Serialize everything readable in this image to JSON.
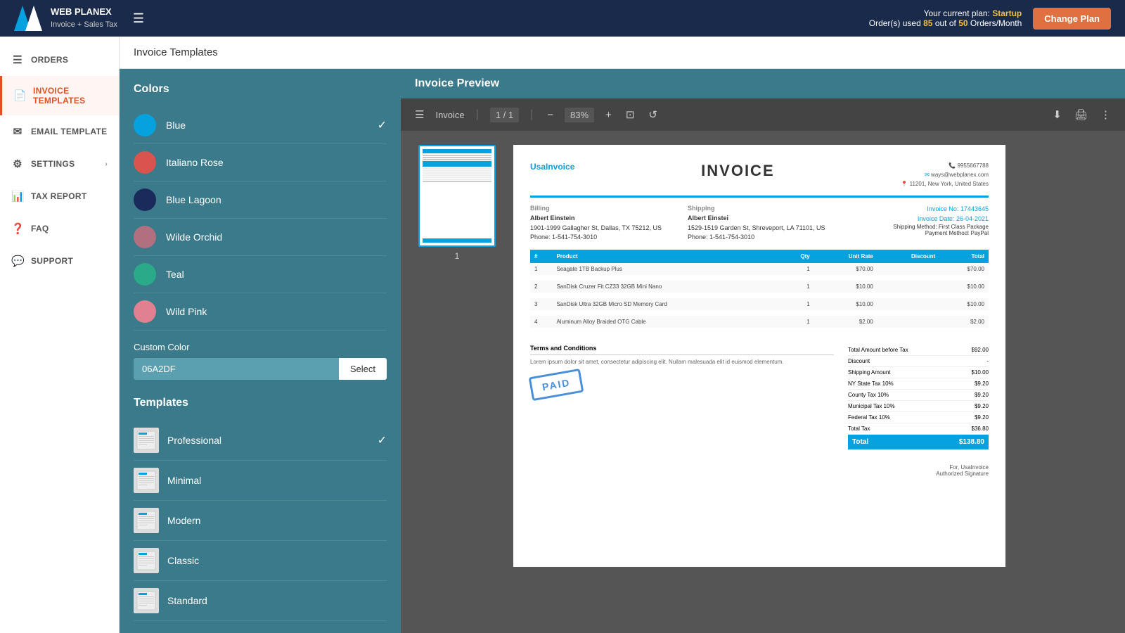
{
  "header": {
    "logo_text": "WEB PLANEX",
    "logo_sub": "Invoice + Sales Tax",
    "plan_label": "Your current plan:",
    "plan_name": "Startup",
    "orders_used": "85",
    "orders_total": "50",
    "orders_label": "Order(s) used",
    "orders_suffix": "Orders/Month",
    "change_plan_btn": "Change Plan"
  },
  "sidebar": {
    "items": [
      {
        "id": "orders",
        "label": "ORDERS",
        "icon": "☰"
      },
      {
        "id": "invoice-templates",
        "label": "INVOICE TEMPLATES",
        "icon": "📄",
        "active": true
      },
      {
        "id": "email-template",
        "label": "EMAIL TEMPLATE",
        "icon": "✉"
      },
      {
        "id": "settings",
        "label": "SETTINGS",
        "icon": "⚙",
        "has_chevron": true
      },
      {
        "id": "tax-report",
        "label": "TAX REPORT",
        "icon": "📊"
      },
      {
        "id": "faq",
        "label": "FAQ",
        "icon": "❓"
      },
      {
        "id": "support",
        "label": "SUPPORT",
        "icon": "💬"
      }
    ]
  },
  "page_title": "Invoice Templates",
  "left_panel": {
    "colors_section_title": "Colors",
    "colors": [
      {
        "id": "blue",
        "name": "Blue",
        "hex": "#06a2df",
        "selected": true
      },
      {
        "id": "italiano-rose",
        "name": "Italiano Rose",
        "hex": "#d9534f"
      },
      {
        "id": "blue-lagoon",
        "name": "Blue Lagoon",
        "hex": "#1a2a5a"
      },
      {
        "id": "wilde-orchid",
        "name": "Wilde Orchid",
        "hex": "#b07080"
      },
      {
        "id": "teal",
        "name": "Teal",
        "hex": "#2aaa88"
      },
      {
        "id": "wild-pink",
        "name": "Wild Pink",
        "hex": "#e08090"
      }
    ],
    "custom_color_label": "Custom Color",
    "custom_color_value": "06A2DF",
    "select_btn_label": "Select",
    "templates_section_title": "Templates",
    "templates": [
      {
        "id": "professional",
        "name": "Professional",
        "selected": true
      },
      {
        "id": "minimal",
        "name": "Minimal"
      },
      {
        "id": "modern",
        "name": "Modern"
      },
      {
        "id": "classic",
        "name": "Classic"
      },
      {
        "id": "standard",
        "name": "Standard"
      }
    ]
  },
  "preview": {
    "title": "Invoice Preview",
    "toolbar": {
      "menu_icon": "☰",
      "label": "Invoice",
      "page_current": "1",
      "page_total": "1",
      "zoom_level": "83%",
      "page_num": "1"
    },
    "invoice": {
      "company": "UsaInvoice",
      "title": "INVOICE",
      "phone": "9955667788",
      "email": "ways@webplanex.com",
      "address": "11201, New York, United States",
      "billing_label": "Billing",
      "billing_name": "Albert Einstein",
      "billing_address": "1901-1999 Gallagher St, Dallas, TX 75212, US",
      "billing_phone": "Phone: 1-541-754-3010",
      "shipping_label": "Shipping",
      "shipping_name": "Albert Einsteі",
      "shipping_address": "1529-1519 Garden St, Shreveport, LA 71101, US",
      "shipping_phone": "Phone: 1-541-754-3010",
      "invoice_no_label": "Invoice No:",
      "invoice_no": "17443645",
      "invoice_date_label": "Invoice Date:",
      "invoice_date": "26-04-2021",
      "shipping_method_label": "Shipping Method:",
      "shipping_method": "First Class Package",
      "payment_method_label": "Payment Method:",
      "payment_method": "PayPal",
      "table": {
        "headers": [
          "#",
          "Product",
          "Qty",
          "Unit Rate",
          "Discount",
          "Total"
        ],
        "rows": [
          {
            "num": "1",
            "product": "Seagate 1TB Backup Plus",
            "qty": "1",
            "rate": "$70.00",
            "discount": "",
            "total": "$70.00"
          },
          {
            "num": "2",
            "product": "SanDisk Cruzer Fit CZ33 32GB Mini Nano",
            "qty": "1",
            "rate": "$10.00",
            "discount": "",
            "total": "$10.00"
          },
          {
            "num": "3",
            "product": "SanDisk Ultra 32GB Micro SD Memory Card",
            "qty": "1",
            "rate": "$10.00",
            "discount": "",
            "total": "$10.00"
          },
          {
            "num": "4",
            "product": "Aluminum Alloy Braided OTG Cable",
            "qty": "1",
            "rate": "$2.00",
            "discount": "",
            "total": "$2.00"
          }
        ]
      },
      "terms_label": "Terms and Conditions",
      "terms_text": "Lorem ipsum dolor sit amet, consectetur adipiscing elit. Nullam malesuada elit id euismod elementum.",
      "paid_stamp": "PAID",
      "totals": [
        {
          "label": "Total Amount before Tax",
          "value": "$92.00"
        },
        {
          "label": "Discount",
          "value": "-"
        },
        {
          "label": "Shipping Amount",
          "value": "$10.00"
        },
        {
          "label": "NY State Tax 10%",
          "value": "$9.20"
        },
        {
          "label": "County Tax 10%",
          "value": "$9.20"
        },
        {
          "label": "Municipal Tax 10%",
          "value": "$9.20"
        },
        {
          "label": "Federal Tax 10%",
          "value": "$9.20"
        },
        {
          "label": "Total Tax",
          "value": "$36.80"
        }
      ],
      "grand_total_label": "Total",
      "grand_total_value": "$138.80",
      "sign_label": "For, UsaInvoice",
      "sign_sub": "Authorized Signature"
    }
  }
}
